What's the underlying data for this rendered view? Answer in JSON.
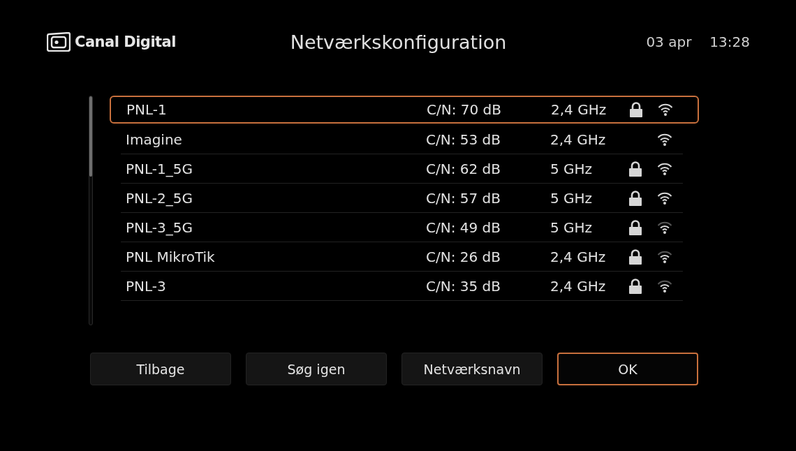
{
  "header": {
    "logo": "Canal Digital",
    "title": "Netværkskonfiguration",
    "date": "03 apr",
    "time": "13:28"
  },
  "networks": [
    {
      "name": "PNL-1",
      "cn": "C/N: 70 dB",
      "band": "2,4 GHz",
      "locked": true,
      "strong_signal": true,
      "selected": true
    },
    {
      "name": "Imagine",
      "cn": "C/N: 53 dB",
      "band": "2,4 GHz",
      "locked": false,
      "strong_signal": true,
      "selected": false
    },
    {
      "name": "PNL-1_5G",
      "cn": "C/N: 62 dB",
      "band": "5 GHz",
      "locked": true,
      "strong_signal": true,
      "selected": false
    },
    {
      "name": "PNL-2_5G",
      "cn": "C/N: 57 dB",
      "band": "5 GHz",
      "locked": true,
      "strong_signal": true,
      "selected": false
    },
    {
      "name": "PNL-3_5G",
      "cn": "C/N: 49 dB",
      "band": "5 GHz",
      "locked": true,
      "strong_signal": false,
      "selected": false
    },
    {
      "name": "PNL MikroTik",
      "cn": "C/N: 26 dB",
      "band": "2,4 GHz",
      "locked": true,
      "strong_signal": false,
      "selected": false
    },
    {
      "name": "PNL-3",
      "cn": "C/N: 35 dB",
      "band": "2,4 GHz",
      "locked": true,
      "strong_signal": false,
      "selected": false
    }
  ],
  "buttons": [
    {
      "label": "Tilbage",
      "selected": false
    },
    {
      "label": "Søg igen",
      "selected": false
    },
    {
      "label": "Netværksnavn",
      "selected": false
    },
    {
      "label": "OK",
      "selected": true
    }
  ]
}
